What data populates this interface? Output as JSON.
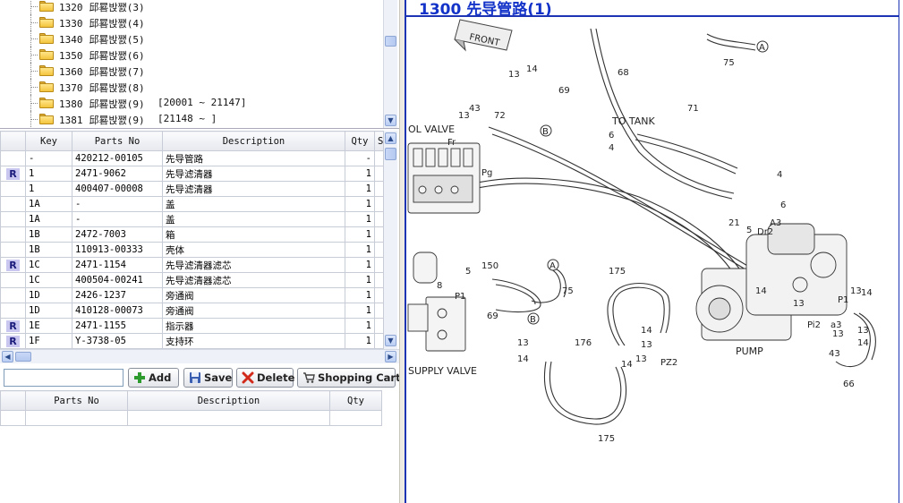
{
  "tree": {
    "items": [
      {
        "code": "1320",
        "name": "邱晷밙쨄(3)",
        "range": ""
      },
      {
        "code": "1330",
        "name": "邱晷밙쨄(4)",
        "range": ""
      },
      {
        "code": "1340",
        "name": "邱晷밙쨄(5)",
        "range": ""
      },
      {
        "code": "1350",
        "name": "邱晷밙쨄(6)",
        "range": ""
      },
      {
        "code": "1360",
        "name": "邱晷밙쨄(7)",
        "range": ""
      },
      {
        "code": "1370",
        "name": "邱晷밙쨄(8)",
        "range": ""
      },
      {
        "code": "1380",
        "name": "邱晷밙쨄(9)",
        "range": "[20001 ~ 21147]"
      },
      {
        "code": "1381",
        "name": "邱晷밙쨄(9)",
        "range": "[21148 ~ ]"
      }
    ]
  },
  "parts_grid": {
    "columns": {
      "key": "Key",
      "parts_no": "Parts No",
      "description": "Description",
      "qty": "Qty",
      "s": "S"
    },
    "rows": [
      {
        "mark": "",
        "key": "-",
        "parts_no": "420212-00105",
        "description": "先导管路",
        "qty": "-"
      },
      {
        "mark": "R",
        "key": "1",
        "parts_no": "2471-9062",
        "description": "先导滤清器",
        "qty": "1"
      },
      {
        "mark": "",
        "key": "1",
        "parts_no": "400407-00008",
        "description": "先导滤清器",
        "qty": "1"
      },
      {
        "mark": "",
        "key": "1A",
        "parts_no": "-",
        "description": "盖",
        "qty": "1"
      },
      {
        "mark": "",
        "key": "1A",
        "parts_no": "-",
        "description": "盖",
        "qty": "1"
      },
      {
        "mark": "",
        "key": "1B",
        "parts_no": "2472-7003",
        "description": "箱",
        "qty": "1"
      },
      {
        "mark": "",
        "key": "1B",
        "parts_no": "110913-00333",
        "description": "壳体",
        "qty": "1"
      },
      {
        "mark": "R",
        "key": "1C",
        "parts_no": "2471-1154",
        "description": "先导滤清器滤芯",
        "qty": "1"
      },
      {
        "mark": "",
        "key": "1C",
        "parts_no": "400504-00241",
        "description": "先导滤清器滤芯",
        "qty": "1"
      },
      {
        "mark": "",
        "key": "1D",
        "parts_no": "2426-1237",
        "description": "旁通阀",
        "qty": "1"
      },
      {
        "mark": "",
        "key": "1D",
        "parts_no": "410128-00073",
        "description": "旁通阀",
        "qty": "1"
      },
      {
        "mark": "R",
        "key": "1E",
        "parts_no": "2471-1155",
        "description": "指示器",
        "qty": "1"
      },
      {
        "mark": "R",
        "key": "1F",
        "parts_no": "Y-3738-05",
        "description": "支持环",
        "qty": "1"
      }
    ]
  },
  "toolbar": {
    "search_value": "",
    "add_label": "Add",
    "save_label": "Save",
    "delete_label": "Delete",
    "cart_label": "Shopping Cart"
  },
  "cart_grid": {
    "columns": {
      "parts_no": "Parts No",
      "description": "Description",
      "qty": "Qty"
    }
  },
  "diagram": {
    "title": "1300 先导管路(1)",
    "labels": {
      "front": "FRONT",
      "control_valve": "OL VALVE",
      "to_tank": "TO TANK",
      "supply_valve": "SUPPLY VALVE",
      "pump": "PUMP",
      "pz2": "PZ2",
      "pi2": "Pi2",
      "a3_upper": "A3",
      "a3_lower": "a3",
      "dr2": "Dr2",
      "pg": "Pg",
      "fr": "Fr",
      "p1_left": "P1",
      "p1_right": "P1",
      "circle_a": "A",
      "circle_b": "B",
      "n4": "4",
      "n5": "5",
      "n6": "6",
      "n8": "8",
      "n13": "13",
      "n14": "14",
      "n21": "21",
      "n43": "43",
      "n66": "66",
      "n68": "68",
      "n69": "69",
      "n71": "71",
      "n72": "72",
      "n75": "75",
      "n150": "150",
      "n175": "175",
      "n176": "176"
    }
  },
  "colors": {
    "title_blue": "#1433c8",
    "mark_bg": "#c9c6f0",
    "folder": "#f4c53d"
  }
}
